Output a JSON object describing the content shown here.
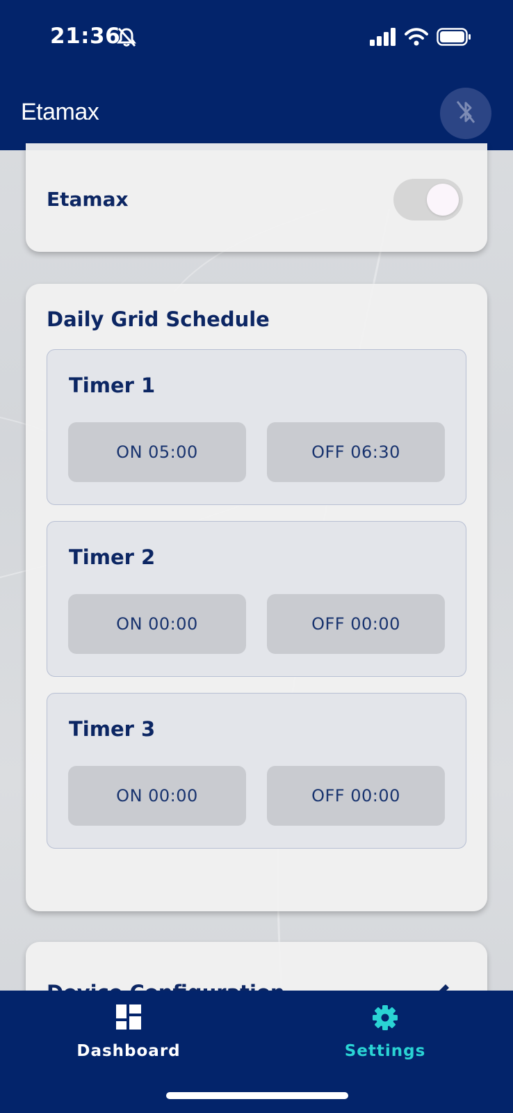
{
  "status_bar": {
    "time": "21:36",
    "icons": [
      "bell-slash-icon",
      "cellular-signal-icon",
      "wifi-icon",
      "battery-icon"
    ]
  },
  "header": {
    "title": "Etamax",
    "bluetooth_icon": "bluetooth-disabled-icon"
  },
  "etamax_card": {
    "label": "Etamax",
    "toggle_on": false
  },
  "schedule": {
    "title": "Daily Grid Schedule",
    "timers": [
      {
        "title": "Timer 1",
        "on": "ON 05:00",
        "off": "OFF 06:30"
      },
      {
        "title": "Timer 2",
        "on": "ON 00:00",
        "off": "OFF 00:00"
      },
      {
        "title": "Timer 3",
        "on": "ON 00:00",
        "off": "OFF 00:00"
      }
    ]
  },
  "config_card": {
    "title": "Device Configuration",
    "icon": "edit-icon"
  },
  "bottom_nav": {
    "items": [
      {
        "label": "Dashboard",
        "icon": "dashboard-icon",
        "active": false
      },
      {
        "label": "Settings",
        "icon": "gear-icon",
        "active": true
      }
    ]
  },
  "colors": {
    "primary": "#03246b",
    "accent": "#2ad4d4",
    "text_dark": "#0c2663"
  }
}
